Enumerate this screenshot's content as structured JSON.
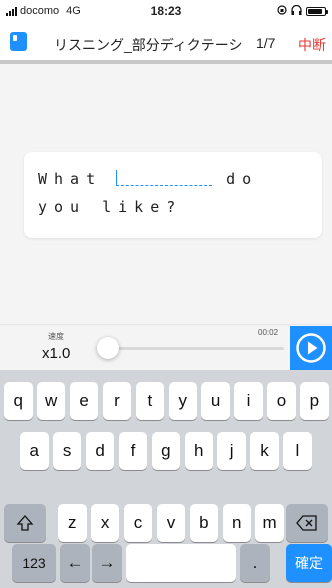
{
  "status_bar": {
    "carrier": "docomo",
    "network": "4G",
    "time": "18:23",
    "battery_level": 0.9
  },
  "nav": {
    "title": "リスニング_部分ディクテーシ…",
    "progress": "1/7",
    "quit_label": "中断"
  },
  "question": {
    "line1_before": "What",
    "line1_after": "do",
    "line2": "you like?"
  },
  "player": {
    "speed_label": "速度",
    "speed_value": "x1.0",
    "time": "00:02",
    "playback_progress": 0.0
  },
  "keyboard": {
    "row1": [
      "q",
      "w",
      "e",
      "r",
      "t",
      "y",
      "u",
      "i",
      "o",
      "p"
    ],
    "row2": [
      "a",
      "s",
      "d",
      "f",
      "g",
      "h",
      "j",
      "k",
      "l"
    ],
    "row3": [
      "z",
      "x",
      "c",
      "v",
      "b",
      "n",
      "m"
    ],
    "numbers_key": "123",
    "left_arrow": "←",
    "right_arrow": "→",
    "space_key": "",
    "period_key": ".",
    "confirm_key": "確定"
  },
  "colors": {
    "accent": "#1e90ff",
    "quit": "#e53935",
    "keyboard_bg": "#d1d4d9"
  }
}
